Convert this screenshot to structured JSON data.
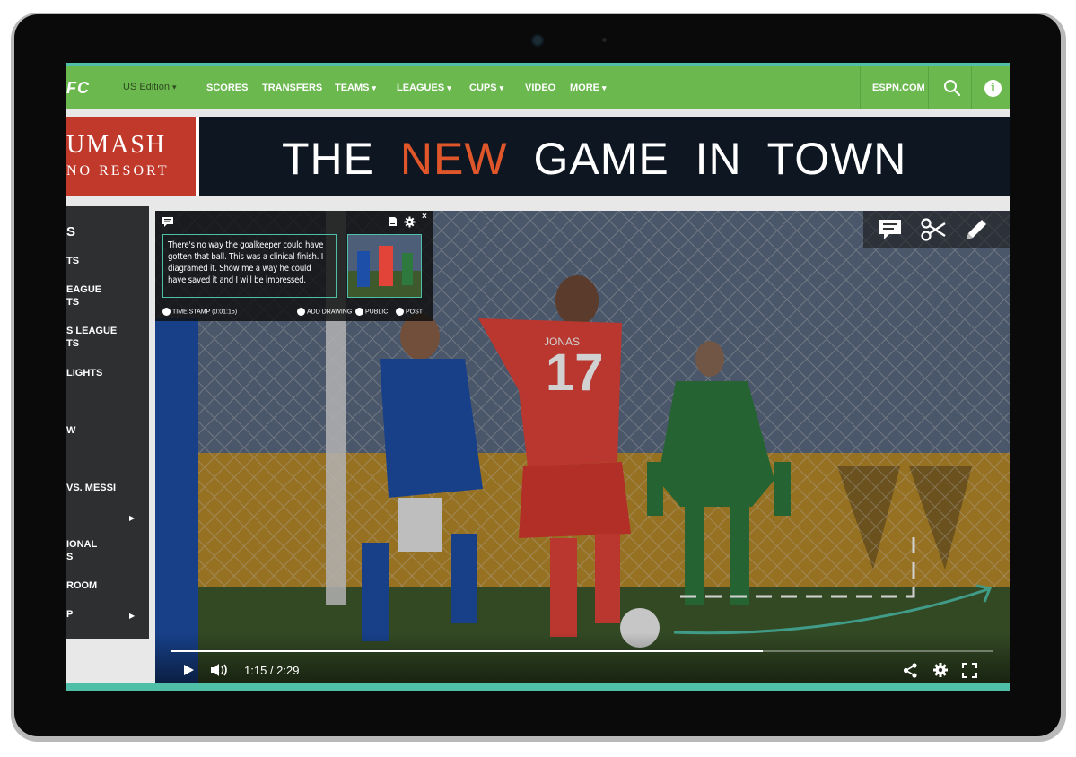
{
  "nav": {
    "logo": "FC",
    "edition": "US Edition",
    "items": [
      {
        "label": "SCORES",
        "dropdown": false
      },
      {
        "label": "TRANSFERS",
        "dropdown": false
      },
      {
        "label": "TEAMS",
        "dropdown": true
      },
      {
        "label": "LEAGUES",
        "dropdown": true
      },
      {
        "label": "CUPS",
        "dropdown": true
      },
      {
        "label": "VIDEO",
        "dropdown": false
      },
      {
        "label": "MORE",
        "dropdown": true
      }
    ],
    "espn": "ESPN.COM",
    "accent_color": "#6ab84e"
  },
  "banner": {
    "brand_line1": "UMASH",
    "brand_line2": "NO RESORT",
    "tagline_pre": "THE ",
    "tagline_highlight": "NEW",
    "tagline_post": " GAME IN TOWN",
    "highlight_color": "#e0562b"
  },
  "sidebar": {
    "items": [
      "S",
      "TS",
      "EAGUE",
      "TS",
      "S LEAGUE",
      "TS",
      "LIGHTS",
      "W",
      "VS. MESSI",
      "IONAL",
      "S",
      "ROOM",
      "P"
    ]
  },
  "comment": {
    "text": "There's no way the goalkeeper could have gotten that ball.  This was a clinical finish. I diagramed it. Show me a way  he could have saved it and I will be impressed.",
    "timestamp": "TIME STAMP (0:01:15)",
    "add_drawing": "ADD DRAWING",
    "public": "PUBLIC",
    "post": "POST"
  },
  "player": {
    "current_time": "1:15",
    "total_time": "2:29",
    "progress": 0.72,
    "jersey_number": "17",
    "jersey_name": "JONAS"
  },
  "icons": {
    "toolbar": [
      "comment-icon",
      "scissors-icon",
      "pencil-icon"
    ],
    "controls": [
      "play-icon",
      "volume-icon",
      "share-icon",
      "gear-icon",
      "fullscreen-icon"
    ]
  }
}
